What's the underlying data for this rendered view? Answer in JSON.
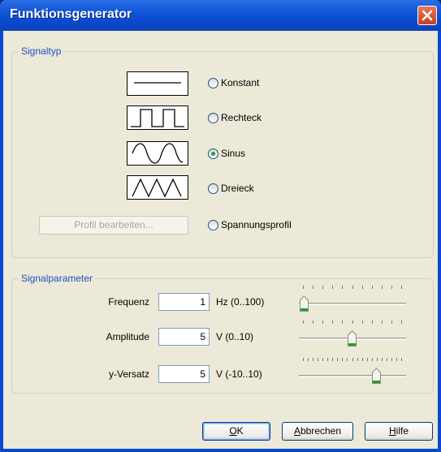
{
  "window": {
    "title": "Funktionsgenerator"
  },
  "signaltyp": {
    "legend": "Signaltyp",
    "options": [
      {
        "label": "Konstant",
        "selected": false,
        "icon": "constant-line-icon"
      },
      {
        "label": "Rechteck",
        "selected": false,
        "icon": "square-wave-icon"
      },
      {
        "label": "Sinus",
        "selected": true,
        "icon": "sine-wave-icon"
      },
      {
        "label": "Dreieck",
        "selected": false,
        "icon": "triangle-wave-icon"
      },
      {
        "label": "Spannungsprofil",
        "selected": false
      }
    ],
    "profile_button": "Profil bearbeiten..."
  },
  "signalparameter": {
    "legend": "Signalparameter",
    "params": [
      {
        "label": "Frequenz",
        "value": "1",
        "unit": "Hz (0..100)",
        "min": 0,
        "max": 100,
        "current": 1
      },
      {
        "label": "Amplitude",
        "value": "5",
        "unit": "V (0..10)",
        "min": 0,
        "max": 10,
        "current": 5
      },
      {
        "label": "y-Versatz",
        "value": "5",
        "unit": "V (-10..10)",
        "min": -10,
        "max": 10,
        "current": 5
      }
    ]
  },
  "buttons": {
    "ok": "OK",
    "cancel": "Abbrechen",
    "help": "Hilfe"
  },
  "colors": {
    "title_bar": "#0a49cf",
    "close": "#d9532c",
    "legend": "#1f4fc4",
    "radio_dot": "#21a121",
    "slider_thumb": "#21a121"
  }
}
